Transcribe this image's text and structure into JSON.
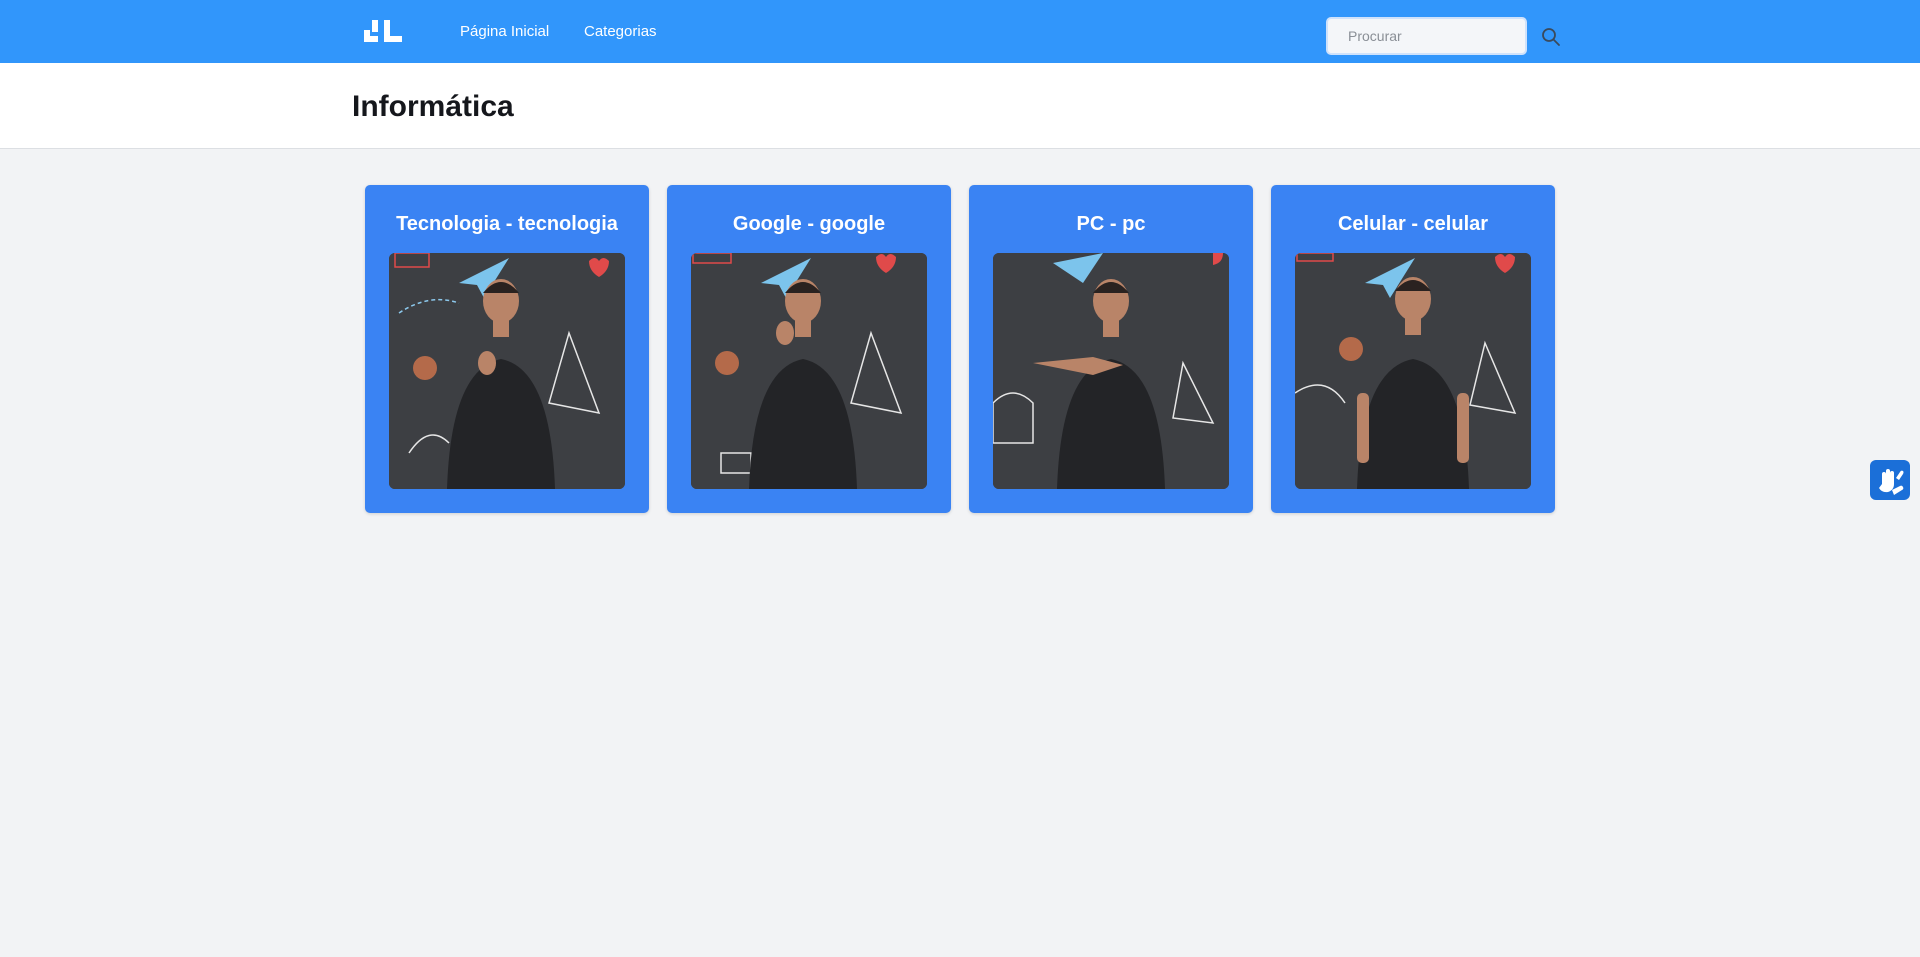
{
  "navbar": {
    "logo_icon": "hands-logo-icon",
    "links": [
      {
        "label": "Página Inicial"
      },
      {
        "label": "Categorias"
      }
    ],
    "search": {
      "placeholder": "Procurar",
      "value": "",
      "icon": "search-icon"
    }
  },
  "header": {
    "title": "Informática"
  },
  "cards": [
    {
      "title": "Tecnologia - tecnologia",
      "image": "sign-language-video-thumbnail"
    },
    {
      "title": "Google - google",
      "image": "sign-language-video-thumbnail"
    },
    {
      "title": "PC - pc",
      "image": "sign-language-video-thumbnail"
    },
    {
      "title": "Celular - celular",
      "image": "sign-language-video-thumbnail"
    }
  ],
  "accessibility": {
    "icon": "vlibras-hands-icon"
  },
  "colors": {
    "navbar": "#3196fb",
    "card": "#3a83f3",
    "background": "#f2f3f5",
    "accessibility_button": "#1b6fd8"
  }
}
